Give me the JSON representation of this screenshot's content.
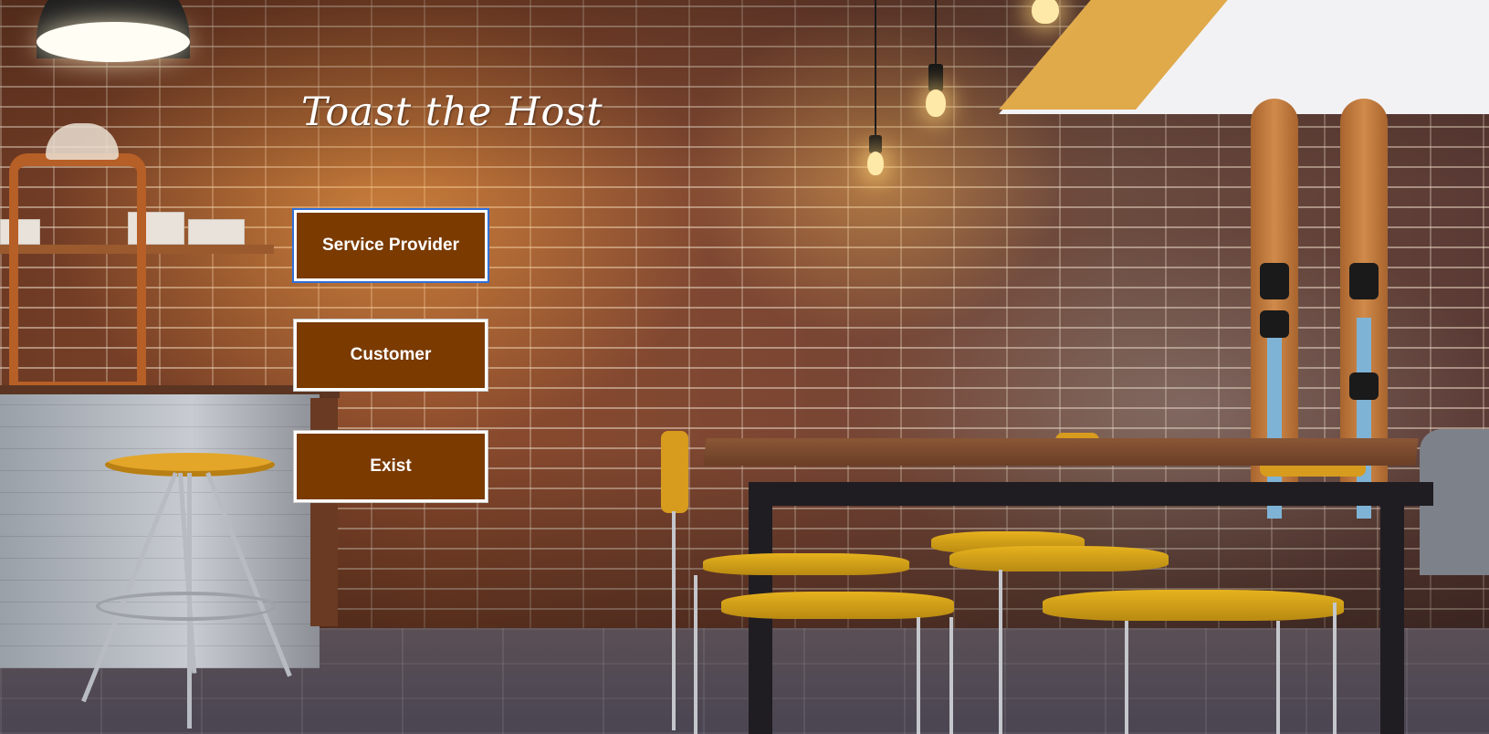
{
  "window": {
    "title": "Toast the Host",
    "background": "cafe-brick-wall-photo"
  },
  "menu": {
    "buttons": [
      {
        "id": "service-provider",
        "label": "Service Provider",
        "focused": true
      },
      {
        "id": "customer",
        "label": "Customer",
        "focused": false
      },
      {
        "id": "exit",
        "label": "Exist",
        "focused": false
      }
    ]
  },
  "colors": {
    "button_fill": "#7a3a00",
    "button_border": "#ffffff",
    "focus_ring": "#2e6fd8",
    "title_text": "#ffffff"
  }
}
